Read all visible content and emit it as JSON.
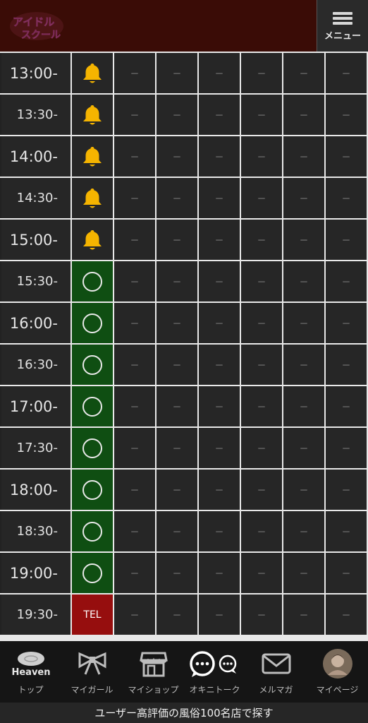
{
  "header": {
    "logo_text": "アイドルスクール",
    "menu_label": "メニュー",
    "colors": {
      "header_bg": "#3a0c06",
      "logo": "#e07fb8"
    }
  },
  "schedule": {
    "rows": [
      {
        "time": "13:00-",
        "type": "hour",
        "status": "bell"
      },
      {
        "time": "13:30-",
        "type": "half",
        "status": "bell"
      },
      {
        "time": "14:00-",
        "type": "hour",
        "status": "bell"
      },
      {
        "time": "14:30-",
        "type": "half",
        "status": "bell"
      },
      {
        "time": "15:00-",
        "type": "hour",
        "status": "bell"
      },
      {
        "time": "15:30-",
        "type": "half",
        "status": "available"
      },
      {
        "time": "16:00-",
        "type": "hour",
        "status": "available"
      },
      {
        "time": "16:30-",
        "type": "half",
        "status": "available"
      },
      {
        "time": "17:00-",
        "type": "hour",
        "status": "available"
      },
      {
        "time": "17:30-",
        "type": "half",
        "status": "available"
      },
      {
        "time": "18:00-",
        "type": "hour",
        "status": "available"
      },
      {
        "time": "18:30-",
        "type": "half",
        "status": "available"
      },
      {
        "time": "19:00-",
        "type": "hour",
        "status": "available"
      },
      {
        "time": "19:30-",
        "type": "half",
        "status": "tel"
      }
    ],
    "tel_label": "TEL",
    "empty_mark": "－",
    "other_columns": 6,
    "colors": {
      "available": "#0f4e12",
      "tel": "#960e0e",
      "bell": "#f5b400"
    }
  },
  "bottom_nav": {
    "items": [
      {
        "label": "トップ",
        "icon": "heaven-logo-icon",
        "badge": "Heaven"
      },
      {
        "label": "マイガール",
        "icon": "ribbon-icon"
      },
      {
        "label": "マイショップ",
        "icon": "shop-icon"
      },
      {
        "label": "オキニトーク",
        "icon": "chat-bubbles-icon"
      },
      {
        "label": "メルマガ",
        "icon": "mail-icon"
      },
      {
        "label": "マイページ",
        "icon": "avatar-icon"
      }
    ]
  },
  "footer": {
    "banner_text": "ユーザー高評価の風俗100名店で探す"
  }
}
